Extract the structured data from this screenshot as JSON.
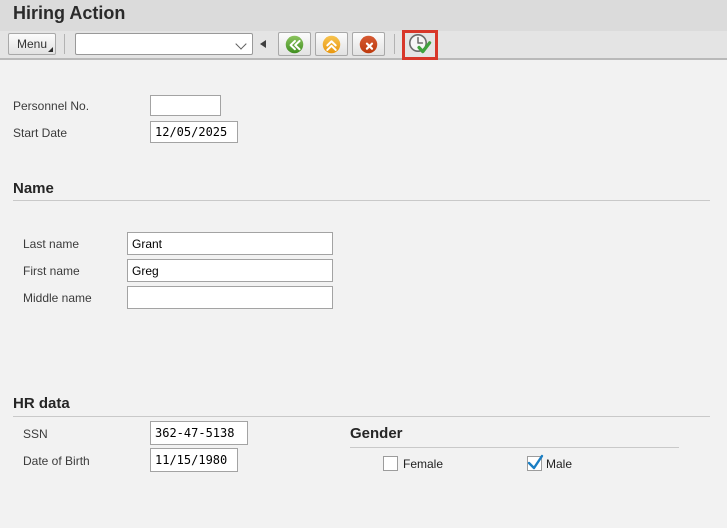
{
  "window": {
    "title": "Hiring Action"
  },
  "toolbar": {
    "menu_button_label": "Menu",
    "command_combobox": {
      "value": ""
    },
    "buttons": [
      {
        "name": "back",
        "icon": "double-chevron-left-green-icon"
      },
      {
        "name": "exit",
        "icon": "double-chevron-up-amber-icon"
      },
      {
        "name": "cancel",
        "icon": "x-red-circle-icon"
      },
      {
        "name": "execute",
        "icon": "clock-check-icon",
        "highlighted": true
      }
    ]
  },
  "form": {
    "personnel_no": {
      "label": "Personnel No.",
      "value": ""
    },
    "start_date": {
      "label": "Start Date",
      "value": "12/05/2025"
    }
  },
  "sections": {
    "name": {
      "title": "Name",
      "last_name": {
        "label": "Last name",
        "value": "Grant"
      },
      "first_name": {
        "label": "First name",
        "value": "Greg"
      },
      "middle_name": {
        "label": "Middle name",
        "value": ""
      }
    },
    "hr_data": {
      "title": "HR data",
      "ssn": {
        "label": "SSN",
        "value": "362-47-5138"
      },
      "date_of_birth": {
        "label": "Date of Birth",
        "value": "11/15/1980"
      }
    },
    "gender": {
      "title": "Gender",
      "female": {
        "label": "Female",
        "checked": false
      },
      "male": {
        "label": "Male",
        "checked": true
      }
    }
  },
  "colors": {
    "highlight_red": "#d8372a",
    "check_blue": "#1b7fc4",
    "icon_green": "#4f9a2c",
    "icon_amber": "#eda41c",
    "icon_red": "#c2410e",
    "titlebar_bg": "#dbdbdb",
    "toolbar_bg": "#e4e4e4",
    "content_bg": "#f2f2f2"
  }
}
